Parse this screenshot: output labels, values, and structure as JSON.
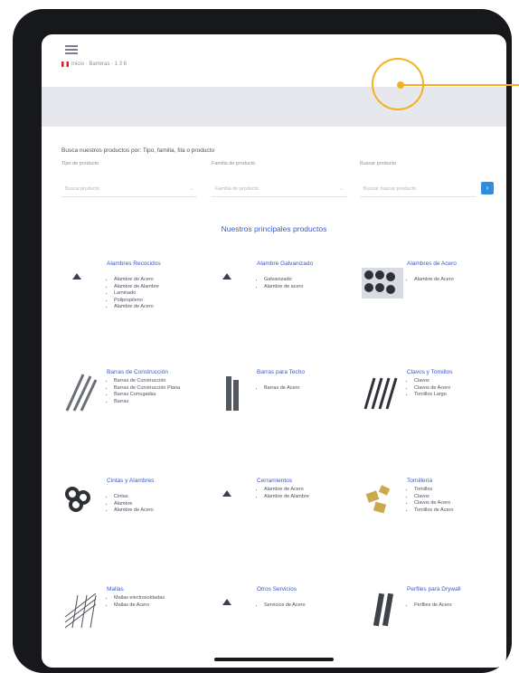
{
  "header": {
    "breadcrumb": "Inicio · Barreras · 1 3 6"
  },
  "search": {
    "title": "Busca nuestros productos por: Tipo, familia, fila o producto",
    "labels": [
      "Tipo de producto",
      "Familia de producto",
      "Buscar producto"
    ],
    "fields": [
      "Busca producto",
      "Familia de producto",
      "Buscar buscar producto"
    ]
  },
  "section_title": "Nuestros principales productos",
  "products": [
    {
      "title": "Alambres Recocidos",
      "items": [
        "Alambre de Acero",
        "Alambre de Alambre",
        "Laminado",
        "Polipropileno",
        "Alambre de Acero"
      ],
      "icon": "placeholder"
    },
    {
      "title": "Alambre Galvanizado",
      "items": [
        "Galvanizado",
        "Alambre de acero"
      ],
      "icon": "placeholder"
    },
    {
      "title": "Alambres de Acero",
      "items": [
        "Alambre de Acero"
      ],
      "icon": "steel-bars"
    },
    {
      "title": "Barras de Construcción",
      "items": [
        "Barras de Construcción",
        "Barras de Construcción Plana",
        "Barras Corrugadas",
        "Barras"
      ],
      "icon": "rebar"
    },
    {
      "title": "Barras para Techo",
      "items": [
        "Barras de Acero"
      ],
      "icon": "metal-plates"
    },
    {
      "title": "Clavos y Tornillos",
      "items": [
        "Clavos",
        "Clavos de Acero",
        "Tornillos Largo"
      ],
      "icon": "rods"
    },
    {
      "title": "Cintas y Alambres",
      "items": [
        "Cintas",
        "Alambre",
        "Alambre de Acero"
      ],
      "icon": "wire-coils"
    },
    {
      "title": "Cerramientos",
      "items": [
        "Alambre de Acero",
        "Alambre de Alambre"
      ],
      "icon": "placeholder"
    },
    {
      "title": "Tornillería",
      "items": [
        "Tornillos",
        "Clavos",
        "Clavos de Acero",
        "Tornillos de Acero"
      ],
      "icon": "hardware"
    },
    {
      "title": "Mallas",
      "items": [
        "Mallas electrosoldadas",
        "Mallas de Acero"
      ],
      "icon": "mesh"
    },
    {
      "title": "Otros Servicios",
      "items": [
        "Servicios de Acero"
      ],
      "icon": "placeholder"
    },
    {
      "title": "Perfiles para Drywall",
      "items": [
        "Perfiles de Acero"
      ],
      "icon": "profiles"
    }
  ],
  "colors": {
    "accent": "#3b5bd0",
    "highlight": "#f3b21c",
    "button": "#2f8cdf"
  }
}
